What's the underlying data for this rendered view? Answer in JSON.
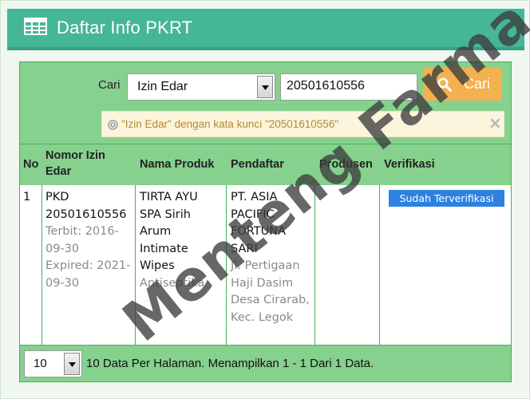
{
  "header": {
    "title": "Daftar Info PKRT",
    "icon": "table-icon",
    "bg_color": "#45b696"
  },
  "search": {
    "label": "Cari",
    "field_selected": "Izin Edar",
    "keyword_value": "20501610556",
    "button_label": "Cari",
    "button_color": "#f3b150"
  },
  "alert": {
    "message": "\"Izin Edar\" dengan kata kunci \"20501610556\"",
    "close_glyph": "×"
  },
  "table": {
    "columns": [
      "No",
      "Nomor Izin Edar",
      "Nama Produk",
      "Pendaftar",
      "Produsen",
      "Verifikasi"
    ],
    "rows": [
      {
        "no": "1",
        "nomor_izin": "PKD 20501610556",
        "terbit": "Terbit: 2016-09-30",
        "expired": "Expired: 2021-09-30",
        "nama_produk": "TIRTA AYU SPA Sirih Arum Intimate Wipes",
        "kategori": "Antiseptika",
        "pendaftar": "PT. ASIA PACIFIC FORTUNA SARI",
        "alamat": "Jl. Pertigaan Haji Dasim Desa Cirarab, Kec. Legok",
        "produsen": "",
        "verifikasi": "Sudah Terverifikasi"
      }
    ]
  },
  "pager": {
    "per_page": "10",
    "info": "10 Data Per Halaman. Menampilkan 1 - 1 Dari 1 Data."
  },
  "watermark": "Menteng Farma"
}
